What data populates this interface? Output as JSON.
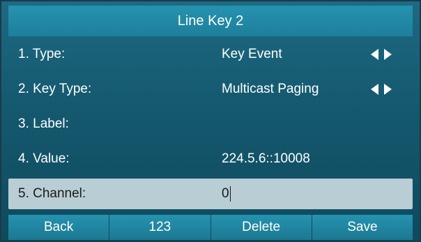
{
  "title": "Line Key 2",
  "fields": [
    {
      "label": "1. Type:",
      "value": "Key Event",
      "has_arrows": true
    },
    {
      "label": "2. Key Type:",
      "value": "Multicast Paging",
      "has_arrows": true
    },
    {
      "label": "3. Label:",
      "value": "",
      "has_arrows": false
    },
    {
      "label": "4. Value:",
      "value": "224.5.6::10008",
      "has_arrows": false
    },
    {
      "label": "5. Channel:",
      "value": "0",
      "has_arrows": false,
      "selected": true
    }
  ],
  "softkeys": [
    {
      "label": "Back"
    },
    {
      "label": "123"
    },
    {
      "label": "Delete"
    },
    {
      "label": "Save"
    }
  ],
  "colors": {
    "title_bar": "#1e7f9b",
    "background": "#155a70",
    "selected_row": "#b9cdd4"
  }
}
